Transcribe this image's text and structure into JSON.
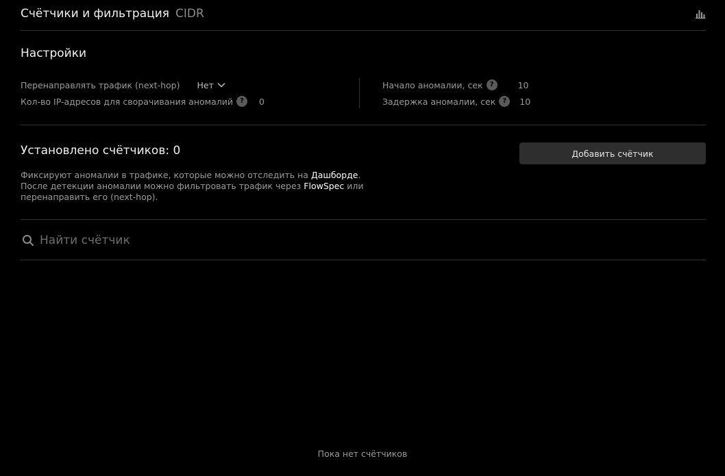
{
  "header": {
    "title": "Счётчики и фильтрация",
    "subtitle": "CIDR",
    "chart_icon": "bar-chart-icon"
  },
  "settings": {
    "title": "Настройки",
    "redirect_label": "Перенаправлять трафик (next-hop)",
    "redirect_value": "Нет",
    "ip_count_label": "Кол-во IP-адресов для сворачивания аномалий",
    "ip_count_value": "0",
    "anomaly_start_label": "Начало аномалии, сек",
    "anomaly_start_value": "10",
    "anomaly_delay_label": "Задержка аномалии, сек",
    "anomaly_delay_value": "10",
    "help_glyph": "?"
  },
  "counters": {
    "title": "Установлено счётчиков: 0",
    "add_button_label": "Добавить счётчик",
    "desc_part1": "Фиксируют аномалии в трафике, которые можно отследить на ",
    "desc_link_dashboard": "Дашборде",
    "desc_part2": ".",
    "desc_part3": "После детекции аномалии можно фильтровать трафик через ",
    "desc_link_flowspec": "FlowSpec",
    "desc_part4": " или перенаправить его (next-hop)."
  },
  "search": {
    "placeholder": "Найти счётчик"
  },
  "empty_state": "Пока нет счётчиков",
  "colors": {
    "background": "#000000",
    "text_primary": "#f0f0f0",
    "text_secondary": "#9a9a9a",
    "button_bg": "#2e2e2e",
    "divider": "#333333"
  }
}
